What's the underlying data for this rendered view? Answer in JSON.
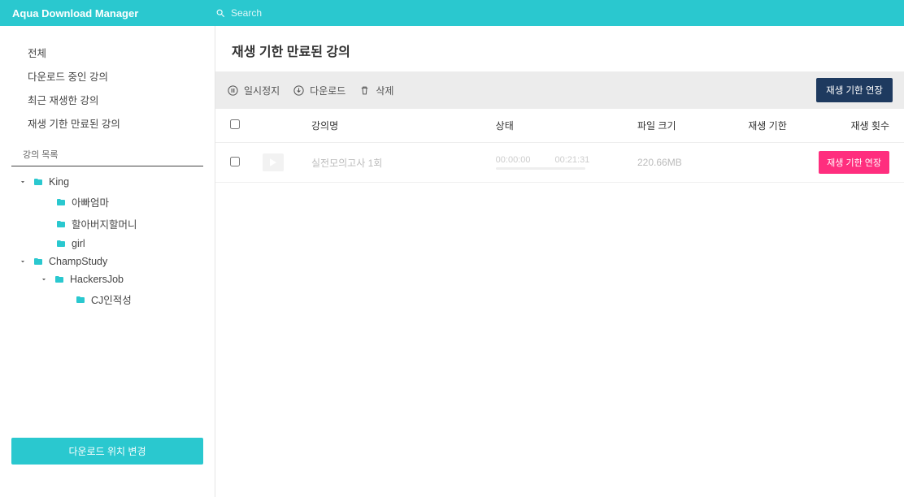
{
  "header": {
    "app_title": "Aqua Download Manager",
    "search_placeholder": "Search"
  },
  "sidebar": {
    "nav_items": [
      "전체",
      "다운로드 중인 강의",
      "최근 재생한 강의",
      "재생 기한 만료된 강의"
    ],
    "section_title": "강의 목록",
    "tree": {
      "king": {
        "label": "King"
      },
      "king_children": [
        "아빠엄마",
        "할아버지할머니",
        "girl"
      ],
      "champ": {
        "label": "ChampStudy"
      },
      "hackers": {
        "label": "HackersJob"
      },
      "cj": {
        "label": "CJ인적성"
      }
    },
    "footer_btn": "다운로드 위치 변경"
  },
  "main": {
    "page_title": "재생 기한 만료된 강의",
    "toolbar": {
      "pause": "일시정지",
      "download": "다운로드",
      "delete": "삭제",
      "extend": "재생 기한 연장"
    },
    "columns": {
      "name": "강의명",
      "status": "상태",
      "size": "파일 크기",
      "deadline": "재생 기한",
      "count": "재생 횟수"
    },
    "rows": [
      {
        "name": "실전모의고사 1회",
        "time_current": "00:00:00",
        "time_total": "00:21:31",
        "size": "220.66MB",
        "action": "재생 기한 연장"
      }
    ]
  }
}
